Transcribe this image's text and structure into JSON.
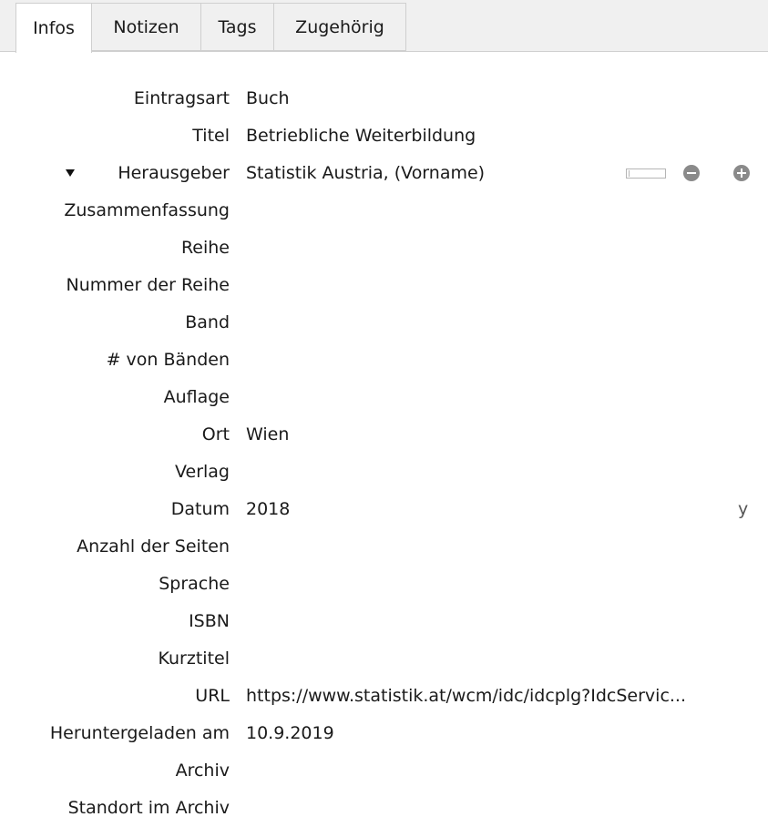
{
  "tabs": [
    {
      "label": "Infos",
      "active": true
    },
    {
      "label": "Notizen",
      "active": false
    },
    {
      "label": "Tags",
      "active": false
    },
    {
      "label": "Zugehörig",
      "active": false
    }
  ],
  "fields": {
    "item_type": {
      "label": "Eintragsart",
      "value": "Buch"
    },
    "title": {
      "label": "Titel",
      "value": "Betriebliche Weiterbildung"
    },
    "editor": {
      "label": "Herausgeber",
      "value": "Statistik Austria, (Vorname)"
    },
    "abstract": {
      "label": "Zusammenfassung",
      "value": ""
    },
    "series": {
      "label": "Reihe",
      "value": ""
    },
    "series_number": {
      "label": "Nummer der Reihe",
      "value": ""
    },
    "volume": {
      "label": "Band",
      "value": ""
    },
    "num_volumes": {
      "label": "# von Bänden",
      "value": ""
    },
    "edition": {
      "label": "Auflage",
      "value": ""
    },
    "place": {
      "label": "Ort",
      "value": "Wien"
    },
    "publisher": {
      "label": "Verlag",
      "value": ""
    },
    "date": {
      "label": "Datum",
      "value": "2018",
      "hint": "y"
    },
    "num_pages": {
      "label": "Anzahl der Seiten",
      "value": ""
    },
    "language": {
      "label": "Sprache",
      "value": ""
    },
    "isbn": {
      "label": "ISBN",
      "value": ""
    },
    "short_title": {
      "label": "Kurztitel",
      "value": ""
    },
    "url": {
      "label": "URL",
      "value": "https://www.statistik.at/wcm/idc/idcplg?IdcServic..."
    },
    "accessed": {
      "label": "Heruntergeladen am",
      "value": "10.9.2019"
    },
    "archive": {
      "label": "Archiv",
      "value": ""
    },
    "archive_location": {
      "label": "Standort im Archiv",
      "value": ""
    }
  },
  "icons": {
    "twisty": "triangle-down-icon",
    "mode_switch": "name-mode-switch-icon",
    "remove": "minus-circle-icon",
    "add": "plus-circle-icon"
  }
}
